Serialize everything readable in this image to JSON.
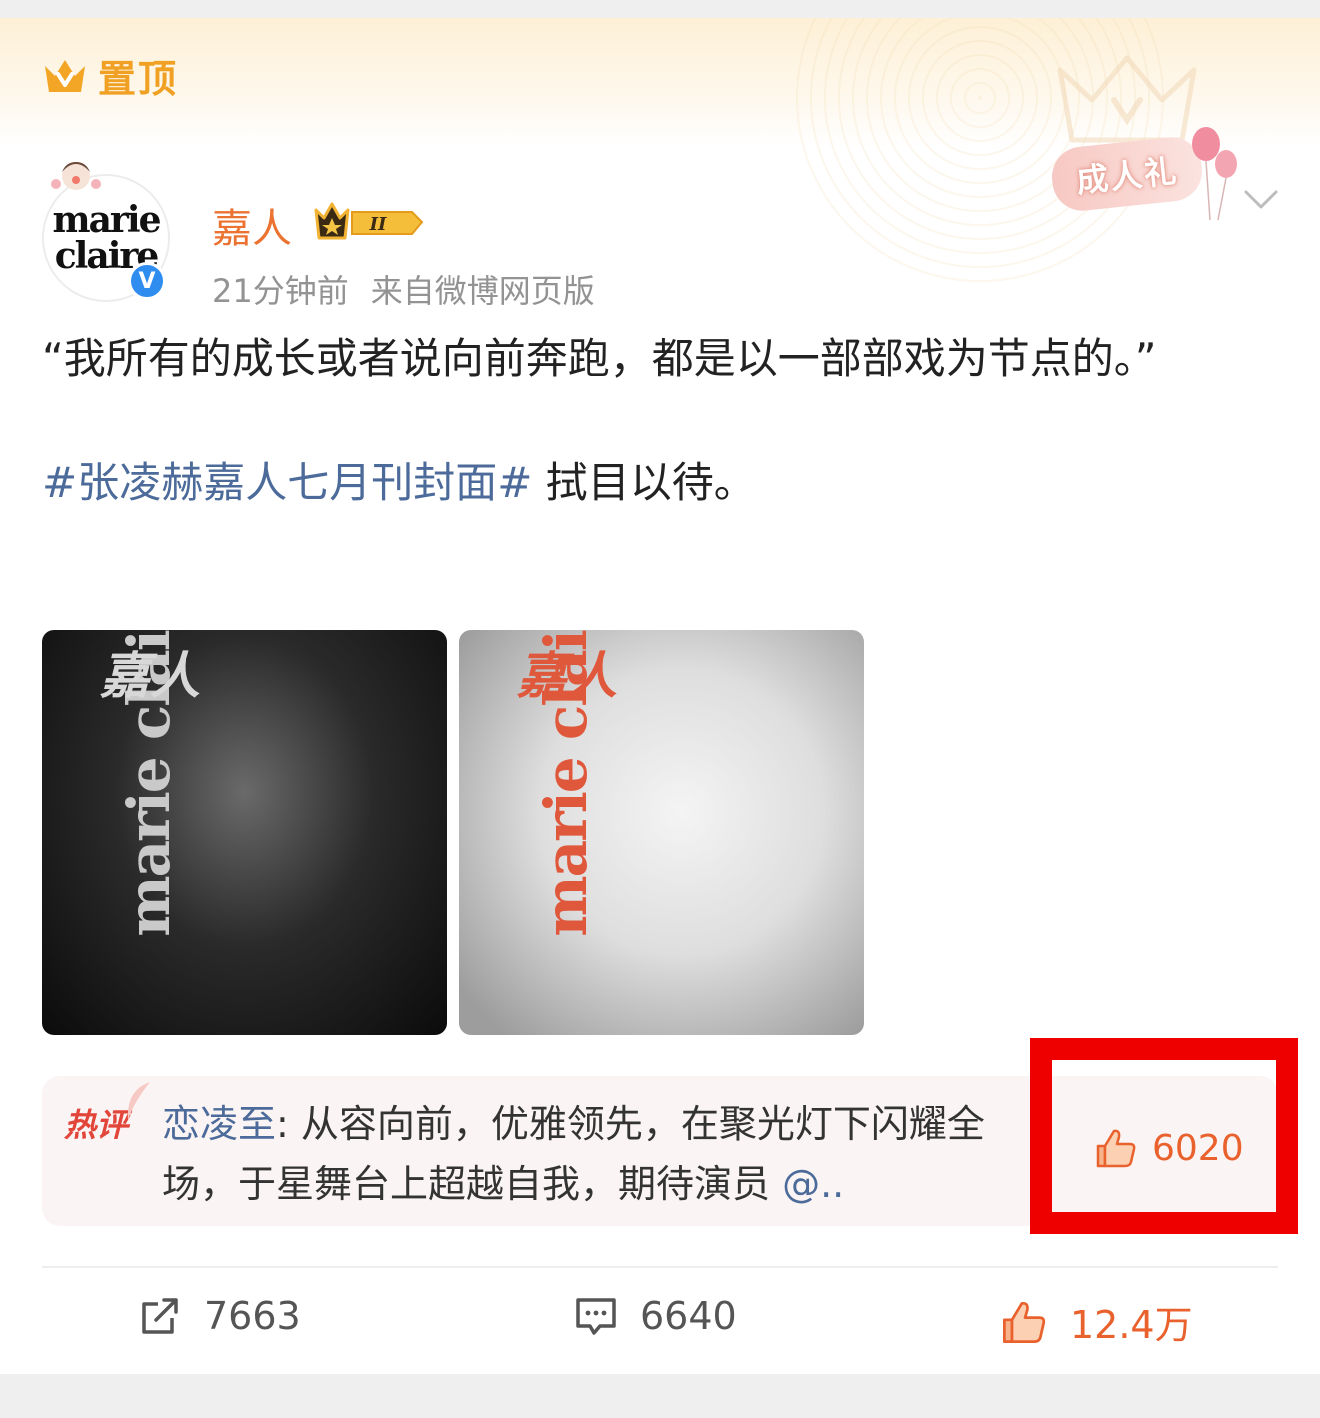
{
  "pin": {
    "label": "置顶",
    "icon": "crown-icon"
  },
  "event_badge": {
    "label": "成人礼"
  },
  "author": {
    "name": "嘉人",
    "avatar_text": [
      "marie",
      "claire"
    ],
    "time": "21分钟前",
    "source": "来自微博网页版",
    "vip_level": "II",
    "verified_mark": "V"
  },
  "post": {
    "line1": "“我所有的成长或者说向前奔跑，都是以一部部戏为节点的。”",
    "topic": "#张凌赫嘉人七月刊封面#",
    "line2": " 拭目以待。"
  },
  "images": [
    {
      "masthead": "marie clai",
      "title": "嘉人"
    },
    {
      "masthead": "marie clai",
      "title": "嘉人"
    }
  ],
  "hot_comment": {
    "tag": "热评",
    "user": "恋凌至",
    "separator": ": ",
    "text": "从容向前，优雅领先，在聚光灯下闪耀全场，于星舞台上超越自我，期待演员 ",
    "mention": "@..",
    "likes": "6020"
  },
  "actions": {
    "reposts": "7663",
    "comments": "6640",
    "likes": "12.4万"
  },
  "colors": {
    "accent_orange": "#eb7230",
    "link_blue": "#4c6b9a",
    "highlight_red": "#ee0000",
    "pin_gold": "#f0a023"
  }
}
